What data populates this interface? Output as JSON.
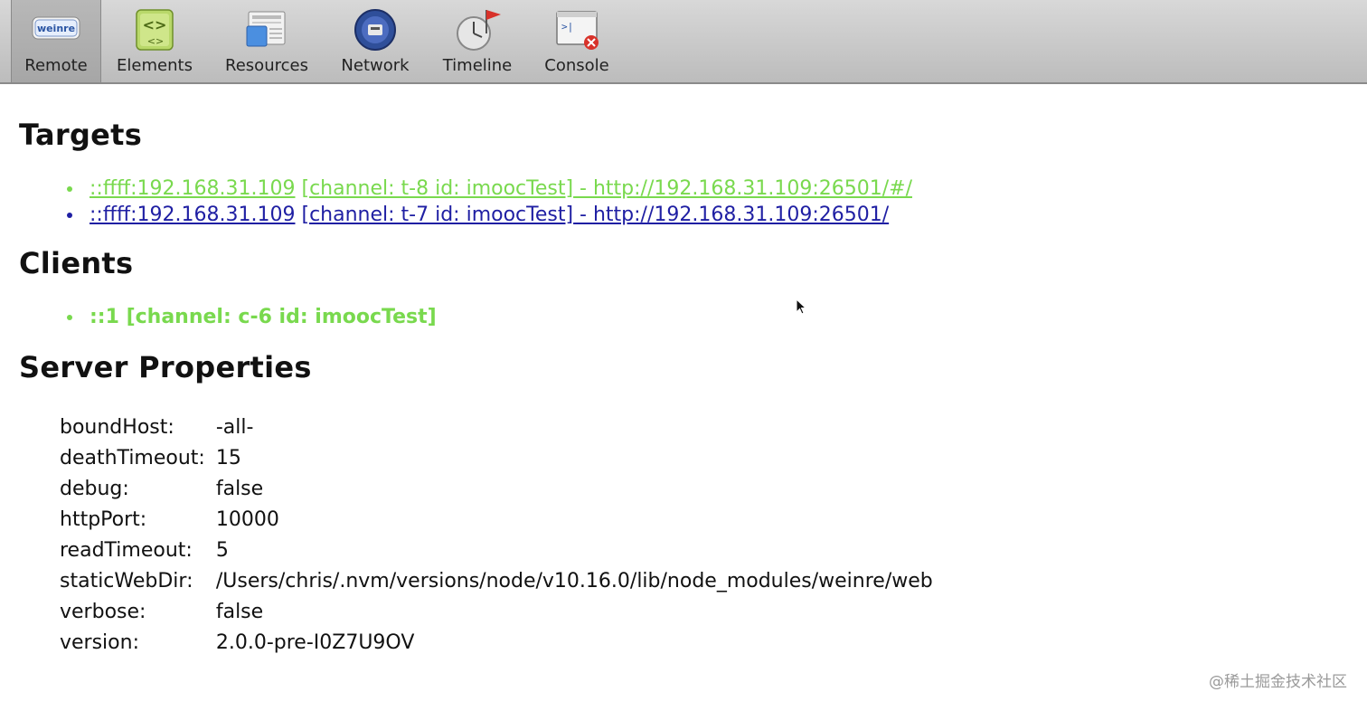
{
  "toolbar": {
    "tabs": [
      {
        "label": "Remote",
        "icon": "weinre-logo-icon",
        "selected": true
      },
      {
        "label": "Elements",
        "icon": "elements-icon"
      },
      {
        "label": "Resources",
        "icon": "resources-icon"
      },
      {
        "label": "Network",
        "icon": "network-icon"
      },
      {
        "label": "Timeline",
        "icon": "timeline-icon"
      },
      {
        "label": "Console",
        "icon": "console-icon"
      }
    ],
    "logo_text": "weinre"
  },
  "targets": {
    "heading": "Targets",
    "items": [
      {
        "host": "::ffff:192.168.31.109",
        "channel": "[channel: t-8 id: imoocTest]",
        "sep": " - ",
        "url": "http://192.168.31.109:26501/#/",
        "color": "#79d94e"
      },
      {
        "host": "::ffff:192.168.31.109",
        "channel": "[channel: t-7 id: imoocTest]",
        "sep": " - ",
        "url": "http://192.168.31.109:26501/",
        "color": "#1f1fa3"
      }
    ]
  },
  "clients": {
    "heading": "Clients",
    "items": [
      {
        "text": "::1 [channel: c-6 id: imoocTest]",
        "color": "#79d94e"
      }
    ]
  },
  "server_properties": {
    "heading": "Server Properties",
    "rows": [
      {
        "key": "boundHost:",
        "value": "-all-"
      },
      {
        "key": "deathTimeout:",
        "value": "15"
      },
      {
        "key": "debug:",
        "value": "false"
      },
      {
        "key": "httpPort:",
        "value": "10000"
      },
      {
        "key": "readTimeout:",
        "value": "5"
      },
      {
        "key": "staticWebDir:",
        "value": "/Users/chris/.nvm/versions/node/v10.16.0/lib/node_modules/weinre/web"
      },
      {
        "key": "verbose:",
        "value": "false"
      },
      {
        "key": "version:",
        "value": "2.0.0-pre-I0Z7U9OV"
      }
    ]
  },
  "watermark": "@稀土掘金技术社区"
}
